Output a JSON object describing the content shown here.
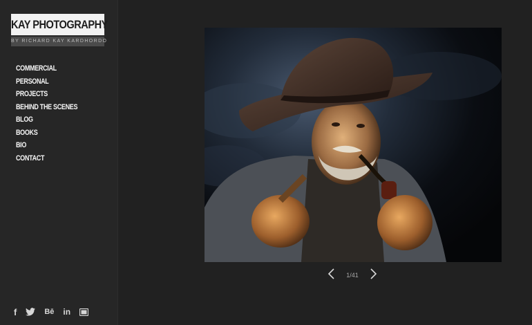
{
  "logo": {
    "title": "KAY PHOTOGRAPHY",
    "subtitle": "BY RICHARD KAY KARDHORDO"
  },
  "nav": {
    "items": [
      {
        "label": "COMMERCIAL"
      },
      {
        "label": "PERSONAL"
      },
      {
        "label": "PROJECTS"
      },
      {
        "label": "BEHIND THE SCENES"
      },
      {
        "label": "BLOG"
      },
      {
        "label": "BOOKS"
      },
      {
        "label": "BIO"
      },
      {
        "label": "CONTACT"
      }
    ]
  },
  "social": {
    "facebook": "f",
    "twitter": "twitter-icon",
    "behance": "Bē",
    "linkedin": "in",
    "email": "mail-icon"
  },
  "gallery": {
    "counter": "1/41"
  },
  "colors": {
    "background": "#212121",
    "sidebar": "#262626",
    "logo_bg": "#f2f2f2",
    "text": "#f5f5f5"
  }
}
